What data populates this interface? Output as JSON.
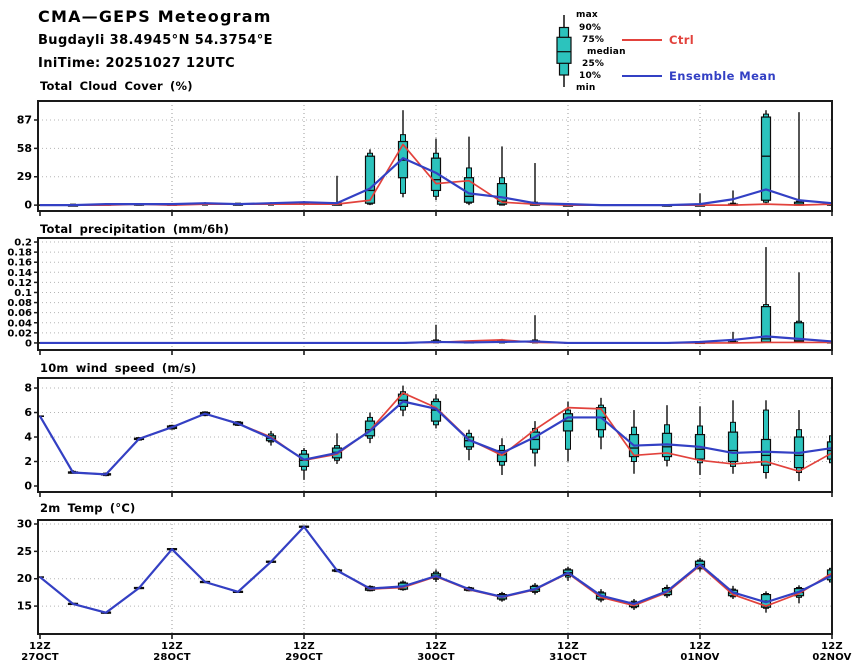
{
  "header": {
    "title": "CMA—GEPS Meteogram",
    "location": "Bugdayli 38.4945°N 54.3754°E",
    "initime": "IniTime: 20251027 12UTC"
  },
  "legend": {
    "box_labels": [
      "max",
      "90%",
      "75%",
      "median",
      "25%",
      "10%",
      "min"
    ],
    "ctrl_label": "Ctrl",
    "mean_label": "Ensemble Mean"
  },
  "colors": {
    "ctrl": "#e2423c",
    "ensemble_mean": "#3340c4",
    "box_fill": "#2cc3bd",
    "box_stroke": "#0d0d0d",
    "grid": "#9a9a9a",
    "frame": "#1a1a1a"
  },
  "x_axis": {
    "n_points": 25,
    "step_hours": 6,
    "grid_indices": [
      4,
      8,
      12,
      16,
      20
    ],
    "ticks": [
      {
        "i": 0,
        "time": "12Z",
        "date": "27OCT"
      },
      {
        "i": 4,
        "time": "12Z",
        "date": "28OCT"
      },
      {
        "i": 8,
        "time": "12Z",
        "date": "29OCT"
      },
      {
        "i": 12,
        "time": "12Z",
        "date": "30OCT"
      },
      {
        "i": 16,
        "time": "12Z",
        "date": "31OCT"
      },
      {
        "i": 20,
        "time": "12Z",
        "date": "01NOV"
      },
      {
        "i": 24,
        "time": "12Z",
        "date": "02NOV"
      }
    ]
  },
  "chart_data": [
    {
      "type": "boxplot-line",
      "title": "Total Cloud Cover (%)",
      "ylim": [
        -6,
        106.4
      ],
      "ytick_values": [
        87,
        58,
        29,
        0
      ],
      "ytick_labels": [
        "87",
        "58",
        "29",
        "0"
      ],
      "box": {
        "min": [
          0,
          0,
          0,
          0,
          0,
          0,
          0,
          0,
          0,
          0,
          0,
          8,
          5,
          0,
          0,
          0,
          0,
          0,
          0,
          0,
          0,
          0,
          2,
          0,
          0
        ],
        "p10": [
          0,
          0,
          0,
          0,
          0,
          0,
          0,
          0,
          1,
          0,
          1,
          12,
          9,
          2,
          0,
          0,
          0,
          0,
          0,
          0,
          0,
          0,
          3,
          0,
          0
        ],
        "p25": [
          0,
          0,
          0,
          0,
          0,
          1,
          0,
          1,
          1,
          0,
          2,
          28,
          15,
          3,
          1,
          0,
          0,
          0,
          0,
          0,
          0,
          0,
          5,
          0,
          0
        ],
        "median": [
          0,
          0,
          1,
          1,
          0,
          1,
          1,
          1,
          2,
          1,
          15,
          46,
          26,
          9,
          4,
          1,
          0,
          0,
          0,
          0,
          0,
          1,
          50,
          1,
          1
        ],
        "p75": [
          0,
          0,
          1,
          1,
          1,
          2,
          1,
          2,
          2,
          2,
          50,
          65,
          48,
          28,
          22,
          2,
          0,
          0,
          0,
          0,
          0,
          1,
          90,
          3,
          1
        ],
        "p90": [
          0,
          1,
          1,
          1,
          1,
          2,
          2,
          2,
          3,
          2,
          53,
          72,
          53,
          38,
          28,
          3,
          1,
          0,
          0,
          0,
          1,
          2,
          93,
          4,
          2
        ],
        "max": [
          0,
          1,
          2,
          2,
          1,
          3,
          2,
          3,
          4,
          30,
          57,
          97,
          68,
          70,
          60,
          43,
          1,
          0,
          0,
          1,
          12,
          15,
          97,
          95,
          2
        ]
      },
      "series": [
        {
          "name": "Ctrl",
          "values": [
            0,
            0,
            0,
            1,
            0,
            1,
            1,
            1,
            1,
            1,
            5,
            62,
            22,
            25,
            3,
            1,
            0,
            0,
            0,
            0,
            0,
            0,
            1,
            0,
            1
          ]
        },
        {
          "name": "Ensemble Mean",
          "values": [
            0,
            0,
            1,
            1,
            1,
            2,
            1,
            2,
            3,
            2,
            17,
            48,
            33,
            12,
            8,
            2,
            1,
            0,
            0,
            0,
            1,
            6,
            16,
            5,
            2
          ]
        }
      ]
    },
    {
      "type": "boxplot-line",
      "title": "Total precipitation (mm/6h)",
      "ylim": [
        -0.014,
        0.208
      ],
      "ytick_values": [
        0.2,
        0.18,
        0.16,
        0.14,
        0.12,
        0.1,
        0.08,
        0.06,
        0.04,
        0.02,
        0
      ],
      "ytick_labels": [
        "0.2",
        "0.18",
        "0.16",
        "0.14",
        "0.12",
        "0.1",
        "0.08",
        "0.06",
        "0.04",
        "0.02",
        "0"
      ],
      "box": {
        "min": [
          0,
          0,
          0,
          0,
          0,
          0,
          0,
          0,
          0,
          0,
          0,
          0,
          0,
          0,
          0,
          0,
          0,
          0,
          0,
          0,
          0,
          0,
          0,
          0,
          0
        ],
        "p10": [
          0,
          0,
          0,
          0,
          0,
          0,
          0,
          0,
          0,
          0,
          0,
          0,
          0,
          0,
          0,
          0,
          0,
          0,
          0,
          0,
          0,
          0,
          0.001,
          0.001,
          0
        ],
        "p25": [
          0,
          0,
          0,
          0,
          0,
          0,
          0,
          0,
          0,
          0,
          0,
          0,
          0.001,
          0,
          0.001,
          0.001,
          0,
          0,
          0,
          0,
          0,
          0,
          0.002,
          0.002,
          0
        ],
        "median": [
          0,
          0,
          0,
          0,
          0,
          0,
          0,
          0,
          0,
          0,
          0,
          0,
          0.002,
          0.001,
          0.003,
          0.002,
          0,
          0,
          0,
          0,
          0,
          0.001,
          0.008,
          0.004,
          0.001
        ],
        "p75": [
          0,
          0,
          0,
          0,
          0,
          0,
          0,
          0,
          0,
          0,
          0,
          0,
          0.004,
          0.002,
          0.005,
          0.004,
          0,
          0,
          0,
          0,
          0.001,
          0.002,
          0.072,
          0.04,
          0.002
        ],
        "p90": [
          0,
          0,
          0,
          0,
          0,
          0,
          0,
          0,
          0,
          0,
          0,
          0,
          0.006,
          0.003,
          0.006,
          0.006,
          0,
          0,
          0,
          0,
          0.002,
          0.004,
          0.076,
          0.043,
          0.003
        ],
        "max": [
          0,
          0,
          0,
          0,
          0,
          0,
          0,
          0,
          0,
          0,
          0,
          0,
          0.036,
          0.004,
          0.008,
          0.055,
          0,
          0,
          0,
          0,
          0.004,
          0.022,
          0.19,
          0.14,
          0.004
        ]
      },
      "series": [
        {
          "name": "Ctrl",
          "values": [
            0,
            0,
            0,
            0,
            0,
            0,
            0,
            0,
            0,
            0,
            0,
            0,
            0.001,
            0.004,
            0.006,
            0.001,
            0,
            0,
            0,
            0,
            0,
            0,
            0.001,
            0.001,
            0.001
          ]
        },
        {
          "name": "Ensemble Mean",
          "values": [
            0,
            0,
            0,
            0,
            0,
            0,
            0,
            0,
            0,
            0,
            0,
            0,
            0.002,
            0.001,
            0.002,
            0.003,
            0,
            0,
            0,
            0,
            0.002,
            0.006,
            0.013,
            0.008,
            0.003
          ]
        }
      ]
    },
    {
      "type": "boxplot-line",
      "title": "10m wind speed (m/s)",
      "ylim": [
        -0.49,
        8.82
      ],
      "ytick_values": [
        8,
        6,
        4,
        2,
        0
      ],
      "ytick_labels": [
        "8",
        "6",
        "4",
        "2",
        "0"
      ],
      "box": {
        "min": [
          5.7,
          1.0,
          0.8,
          3.7,
          4.6,
          5.7,
          4.9,
          3.3,
          0.5,
          1.8,
          3.5,
          5.7,
          4.7,
          2.1,
          0.9,
          1.6,
          2.0,
          3.0,
          1.0,
          1.6,
          0.9,
          1.0,
          0.6,
          0.4,
          1.5
        ],
        "p10": [
          5.7,
          1.05,
          0.85,
          3.75,
          4.65,
          5.75,
          4.95,
          3.6,
          1.3,
          2.1,
          3.9,
          6.2,
          5.0,
          3.0,
          1.7,
          2.7,
          3.0,
          4.0,
          2.0,
          2.1,
          1.9,
          1.6,
          1.1,
          1.1,
          1.9
        ],
        "p25": [
          5.7,
          1.05,
          0.9,
          3.8,
          4.7,
          5.8,
          5.0,
          3.7,
          1.6,
          2.3,
          4.1,
          6.5,
          5.3,
          3.2,
          2.0,
          3.0,
          4.5,
          4.6,
          2.4,
          2.4,
          2.2,
          2.0,
          1.7,
          1.5,
          2.2
        ],
        "median": [
          5.7,
          1.1,
          0.95,
          3.85,
          4.8,
          5.9,
          5.1,
          3.9,
          2.1,
          2.75,
          4.6,
          7.0,
          6.2,
          3.7,
          2.55,
          3.8,
          5.3,
          5.6,
          3.1,
          3.2,
          3.0,
          2.9,
          2.5,
          2.5,
          2.9
        ],
        "p75": [
          5.7,
          1.15,
          1.0,
          3.9,
          4.9,
          6.0,
          5.2,
          4.1,
          2.6,
          3.1,
          5.3,
          7.5,
          6.9,
          4.0,
          2.9,
          4.4,
          5.9,
          6.4,
          4.2,
          4.3,
          4.2,
          4.4,
          3.8,
          4.0,
          3.6
        ],
        "p90": [
          5.7,
          1.2,
          1.05,
          3.95,
          4.95,
          6.05,
          5.25,
          4.25,
          2.9,
          3.3,
          5.6,
          7.7,
          7.1,
          4.3,
          3.3,
          4.7,
          6.2,
          6.6,
          4.8,
          5.0,
          4.9,
          5.2,
          6.2,
          4.6,
          4.1
        ],
        "max": [
          5.7,
          1.3,
          1.1,
          4.0,
          5.0,
          6.1,
          5.3,
          4.5,
          3.1,
          4.3,
          6.0,
          8.2,
          7.5,
          4.6,
          3.9,
          5.3,
          6.9,
          7.2,
          6.2,
          6.6,
          6.5,
          7.0,
          7.0,
          6.2,
          4.5
        ]
      },
      "series": [
        {
          "name": "Ctrl",
          "values": [
            5.7,
            1.1,
            0.95,
            3.85,
            4.8,
            5.9,
            5.1,
            4.0,
            2.1,
            2.6,
            4.55,
            7.6,
            6.4,
            3.8,
            2.5,
            4.6,
            6.4,
            6.3,
            2.5,
            2.7,
            2.1,
            1.8,
            2.0,
            1.2,
            2.7
          ]
        },
        {
          "name": "Ensemble Mean",
          "values": [
            5.7,
            1.1,
            0.95,
            3.85,
            4.8,
            5.9,
            5.1,
            3.9,
            2.15,
            2.7,
            4.5,
            6.9,
            6.3,
            3.75,
            2.7,
            4.0,
            5.6,
            5.6,
            3.3,
            3.4,
            3.2,
            2.7,
            2.8,
            2.7,
            3.1
          ]
        }
      ]
    },
    {
      "type": "boxplot-line",
      "title": "2m Temp (°C)",
      "ylim": [
        9.9,
        30.73
      ],
      "ytick_values": [
        30,
        25,
        20,
        15
      ],
      "ytick_labels": [
        "30",
        "25",
        "20",
        "15"
      ],
      "box": {
        "min": [
          20.3,
          15.2,
          13.6,
          18.1,
          25.2,
          19.2,
          17.4,
          22.9,
          29.3,
          21.2,
          17.7,
          17.8,
          19.4,
          17.7,
          15.8,
          17.1,
          19.6,
          15.7,
          14.3,
          16.5,
          21.3,
          16.3,
          13.8,
          15.5,
          18.9
        ],
        "p10": [
          20.3,
          15.3,
          13.7,
          18.2,
          25.3,
          19.3,
          17.5,
          23.0,
          29.4,
          21.3,
          17.8,
          18.0,
          19.9,
          17.8,
          16.1,
          17.5,
          20.3,
          16.1,
          14.7,
          16.9,
          21.8,
          16.7,
          14.6,
          16.6,
          19.4
        ],
        "p25": [
          20.3,
          15.3,
          13.7,
          18.2,
          25.3,
          19.3,
          17.5,
          23.0,
          29.4,
          21.4,
          17.9,
          18.1,
          20.1,
          17.9,
          16.3,
          17.7,
          20.6,
          16.3,
          14.9,
          17.1,
          22.0,
          16.9,
          14.8,
          16.9,
          19.8
        ],
        "median": [
          20.3,
          15.4,
          13.8,
          18.3,
          25.4,
          19.4,
          17.6,
          23.1,
          29.5,
          21.5,
          18.2,
          18.6,
          20.5,
          18.1,
          16.7,
          18.1,
          21.1,
          16.8,
          15.3,
          17.6,
          22.6,
          17.4,
          15.9,
          17.5,
          20.7
        ],
        "p75": [
          20.3,
          15.5,
          13.9,
          18.4,
          25.5,
          19.5,
          17.7,
          23.2,
          29.6,
          21.6,
          18.5,
          19.2,
          20.9,
          18.3,
          17.1,
          18.6,
          21.6,
          17.4,
          15.7,
          18.2,
          23.2,
          17.9,
          17.1,
          18.2,
          21.6
        ],
        "p90": [
          20.3,
          15.5,
          13.9,
          18.4,
          25.5,
          19.5,
          17.7,
          23.2,
          29.6,
          21.7,
          18.6,
          19.4,
          21.2,
          18.4,
          17.3,
          18.8,
          21.8,
          17.6,
          15.9,
          18.4,
          23.4,
          18.1,
          17.3,
          18.4,
          21.9
        ],
        "max": [
          20.3,
          15.6,
          14.0,
          18.5,
          25.6,
          19.6,
          17.8,
          23.3,
          29.7,
          21.8,
          18.8,
          19.7,
          21.7,
          18.6,
          17.6,
          19.2,
          22.2,
          18.1,
          16.3,
          18.9,
          23.8,
          18.7,
          17.7,
          18.8,
          22.3
        ]
      },
      "series": [
        {
          "name": "Ctrl",
          "values": [
            20.3,
            15.4,
            13.8,
            18.3,
            25.4,
            19.4,
            17.6,
            23.1,
            29.5,
            21.5,
            18.1,
            18.4,
            20.4,
            18.0,
            16.6,
            18.0,
            21.0,
            16.6,
            15.1,
            17.5,
            22.4,
            17.1,
            15.0,
            17.3,
            21.0
          ]
        },
        {
          "name": "Ensemble Mean",
          "values": [
            20.3,
            15.4,
            13.8,
            18.3,
            25.4,
            19.4,
            17.6,
            23.1,
            29.5,
            21.5,
            18.2,
            18.6,
            20.5,
            18.1,
            16.7,
            18.1,
            21.1,
            16.9,
            15.4,
            17.7,
            22.6,
            17.5,
            15.7,
            17.6,
            20.6
          ]
        }
      ]
    }
  ]
}
